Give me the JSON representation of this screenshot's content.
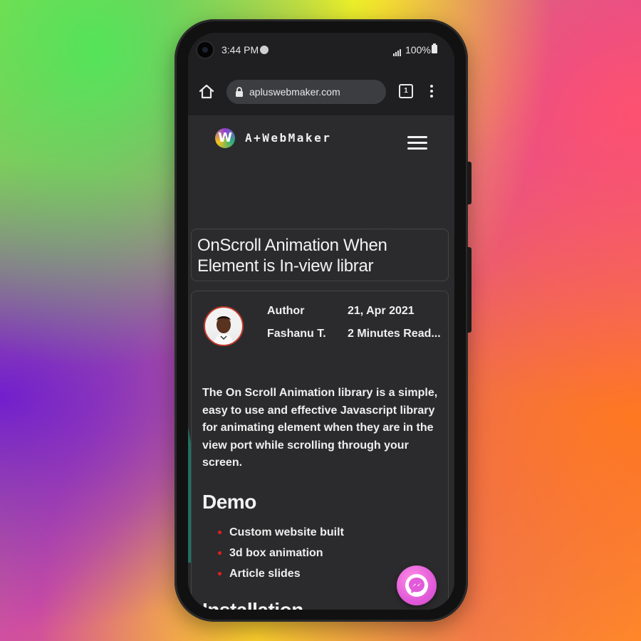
{
  "statusbar": {
    "time": "3:44 PM",
    "battery": "100%"
  },
  "browser": {
    "url": "apluswebmaker.com",
    "tab_count": "1"
  },
  "site": {
    "logo_letter": "W",
    "logo_text": "A+WebMaker"
  },
  "article": {
    "title_line1": "OnScroll Animation When",
    "title_line2": "Element is In-view librar",
    "author_label": "Author",
    "author_name": "Fashanu T.",
    "date": "21, Apr 2021",
    "read_time": "2 Minutes Read...",
    "intro": "The On Scroll Animation library is a simple, easy to use and effective Javascript library for animating element when they are in the view port while scrolling through your screen.",
    "demo_heading": "Demo",
    "demo_items": [
      "Custom website built",
      "3d box animation",
      "Article slides"
    ],
    "install_heading": "Installation"
  },
  "colors": {
    "bullet": "#e0201f",
    "accent_teal": "#1f6f62",
    "messenger": "#e25ad9"
  }
}
